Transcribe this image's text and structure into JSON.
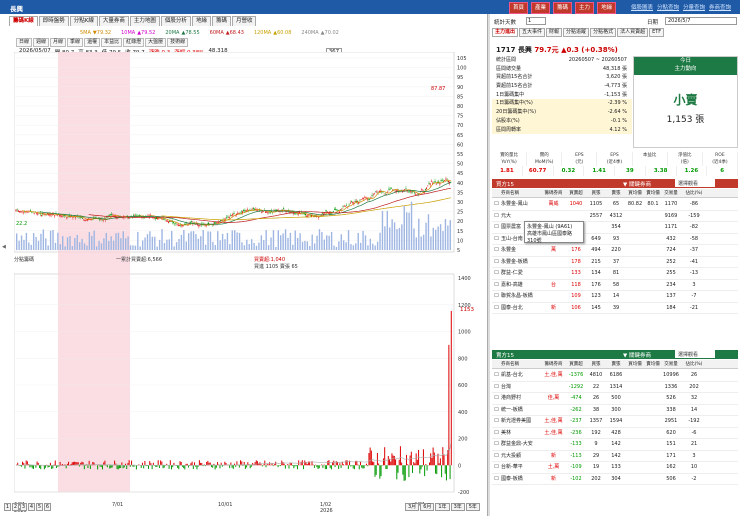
{
  "titlebar": {
    "app": "長興",
    "menus": [
      "首頁",
      "產業",
      "籌碼",
      "主力",
      "地緣"
    ],
    "links": [
      "個股圖表",
      "分點查詢",
      "分量查詢",
      "券商查詢"
    ]
  },
  "left_tabs": [
    "籌碼K線",
    "即時盤勢",
    "分點K線",
    "大量券商",
    "主力地圖",
    "個股分析",
    "地緣",
    "籌碼",
    "月營收"
  ],
  "ma_line": [
    {
      "label": "5MA",
      "val": "▼79.32",
      "color": "#d08a00"
    },
    {
      "label": "10MA",
      "val": "▲79.52",
      "color": "#d000d0"
    },
    {
      "label": "20MA",
      "val": "▲78.55",
      "color": "#1e7a44"
    },
    {
      "label": "60MA",
      "val": "▲68.43",
      "color": "#c02020"
    },
    {
      "label": "120MA",
      "val": "▲60.08",
      "color": "#c8a000"
    },
    {
      "label": "240MA",
      "val": "▲70.02",
      "color": "#888"
    }
  ],
  "tools": [
    "日線",
    "週線",
    "月線",
    "季線",
    "還權",
    "本益比",
    "紅綠燈",
    "大盤壓",
    "技術線"
  ],
  "ohlc": {
    "date": "2026/05/07",
    "open": "開 80.7",
    "high": "高 83.3",
    "low": "低 79.5",
    "close": "收 79.7",
    "change": "漲跌 0.3",
    "pct": "漲幅 0.38%",
    "vol": "48,318",
    "bars": "367"
  },
  "pane_select": "分點籌碼",
  "mid_legend": {
    "left": "一累計買賣超:6,566",
    "right1": "買賣超:1,040",
    "right2": "買進 1105 賣張 65"
  },
  "chart_data": {
    "type": "line",
    "price_axis": [
      "105",
      "100",
      "95",
      "90",
      "85",
      "80",
      "75",
      "70",
      "65",
      "60",
      "55",
      "50",
      "45",
      "40",
      "35",
      "30",
      "25",
      "20",
      "15",
      "10",
      "5"
    ],
    "high_label": "87.87",
    "low_label": "22.2",
    "last_label": "1153.7",
    "vol_axis": [
      "1400",
      "1200",
      "1000",
      "800",
      "600",
      "400",
      "200",
      "0",
      "-200"
    ],
    "x_labels": [
      "6/01",
      "7/01",
      "10/01",
      "1/02",
      "4/01"
    ],
    "x_years": [
      "2025",
      "2026"
    ]
  },
  "pager": [
    "1",
    "2",
    "3",
    "4",
    "5",
    "6"
  ],
  "periods": [
    "3月",
    "6月",
    "1年",
    "3年",
    "5年"
  ],
  "right": {
    "days_label": "統計天數",
    "days_val": "1",
    "date_label": "日期",
    "date_val": "2026/5/7",
    "tabs": [
      "主力進出",
      "五大事件",
      "財報",
      "分點追蹤",
      "分點格式",
      "法人買賣超",
      "ETF"
    ],
    "stock": "1717 長興",
    "price": "79.7元",
    "chg": "▲0.3 (+0.38%)",
    "info": [
      {
        "k": "統計區間",
        "v": "20260507 ~ 20260507"
      },
      {
        "k": "區間總交量",
        "v": "48,318 張"
      },
      {
        "k": "買超前15名合計",
        "v": "3,620 張"
      },
      {
        "k": "賣超前15名合計",
        "v": "-4,773 張"
      },
      {
        "k": "1日籌碼集中",
        "v": "-1,153 張"
      },
      {
        "k": "1日籌碼集中(%)",
        "v": "-2.39 %"
      },
      {
        "k": "20日籌碼集中(%)",
        "v": "-2.64 %"
      },
      {
        "k": "佔股本(%)",
        "v": "-0.1 %"
      },
      {
        "k": "區間周轉率",
        "v": "4.12 %"
      }
    ],
    "big": {
      "h1": "今日",
      "h2": "主力動向",
      "main": "小賣",
      "sub": "1,153 張"
    },
    "stats_h": [
      "實的量比\nYoY(%)",
      "實的\nMoM(%)",
      "EPS\n(元)",
      "EPS\n(近4季)",
      "本益比",
      "淨值比\n(倍)",
      "ROE\n(近4季)"
    ],
    "stats_v": [
      "1.81",
      "60.77",
      "0.32",
      "1.41",
      "39",
      "3.38",
      "1.26",
      "6"
    ],
    "buy_title": "買方15",
    "sell_title": "賣方15",
    "arrow_label": "▼ 關鍵券商",
    "filter": "選擇觀看",
    "cols": [
      "",
      "券商名稱",
      "籌碼券商",
      "買賣超",
      "買張",
      "賣張",
      "買均價",
      "賣均價",
      "交易量",
      "佔比(%)"
    ],
    "buy_rows": [
      [
        "永豐金-鳳山",
        "萬威",
        "1040",
        "1105",
        "65",
        "80.82",
        "80.1",
        "1170",
        "-86"
      ],
      [
        "元大",
        "",
        "",
        "2557",
        "4312",
        "",
        "",
        "9169",
        "-159"
      ],
      [
        "國票農富",
        "",
        "",
        "",
        "354",
        "",
        "",
        "1171",
        "-82"
      ],
      [
        "玉山-台南",
        "",
        "266",
        "649",
        "93",
        "",
        "",
        "432",
        "-58"
      ],
      [
        "永豐金",
        "萬",
        "176",
        "494",
        "220",
        "",
        "",
        "724",
        "-37"
      ],
      [
        "永豐金-板橋",
        "",
        "178",
        "215",
        "37",
        "",
        "",
        "252",
        "-41"
      ],
      [
        "群益-仁愛",
        "",
        "133",
        "134",
        "81",
        "",
        "",
        "255",
        "-13"
      ],
      [
        "嘉和-高雄",
        "台",
        "118",
        "176",
        "58",
        "",
        "",
        "234",
        "3"
      ],
      [
        "聯賀永昌-板橋",
        "",
        "109",
        "123",
        "14",
        "",
        "",
        "137",
        "-7"
      ],
      [
        "國泰-台北",
        "新",
        "106",
        "145",
        "39",
        "",
        "",
        "184",
        "-21"
      ]
    ],
    "sell_rows": [
      [
        "凱基-台北",
        "土,佳,萬",
        "-1376",
        "4810",
        "6186",
        "",
        "",
        "10996",
        "26"
      ],
      [
        "台灣",
        "",
        "-1292",
        "22",
        "1314",
        "",
        "",
        "1336",
        "202"
      ],
      [
        "港商野村",
        "佳,萬",
        "-474",
        "26",
        "500",
        "",
        "",
        "526",
        "32"
      ],
      [
        "統一-板橋",
        "",
        "-262",
        "38",
        "300",
        "",
        "",
        "338",
        "14"
      ],
      [
        "新光證券美國",
        "土,佳,萬",
        "-237",
        "1357",
        "1594",
        "",
        "",
        "2951",
        "-192"
      ],
      [
        "美林",
        "土,佳,萬",
        "-236",
        "192",
        "428",
        "",
        "",
        "620",
        "-6"
      ],
      [
        "群益金鼎-大安",
        "",
        "-133",
        "9",
        "142",
        "",
        "",
        "151",
        "21"
      ],
      [
        "元大投顧",
        "新",
        "-113",
        "29",
        "142",
        "",
        "",
        "171",
        "3"
      ],
      [
        "台新-華平",
        "土,萬",
        "-109",
        "19",
        "133",
        "",
        "",
        "162",
        "10"
      ],
      [
        "國泰-板橋",
        "新",
        "-102",
        "202",
        "304",
        "",
        "",
        "506",
        "-2"
      ]
    ],
    "tooltip": {
      "l1": "永豐金-鳳山 (9A61)",
      "l2": "高雄市鳳山區國泰路310號"
    }
  }
}
